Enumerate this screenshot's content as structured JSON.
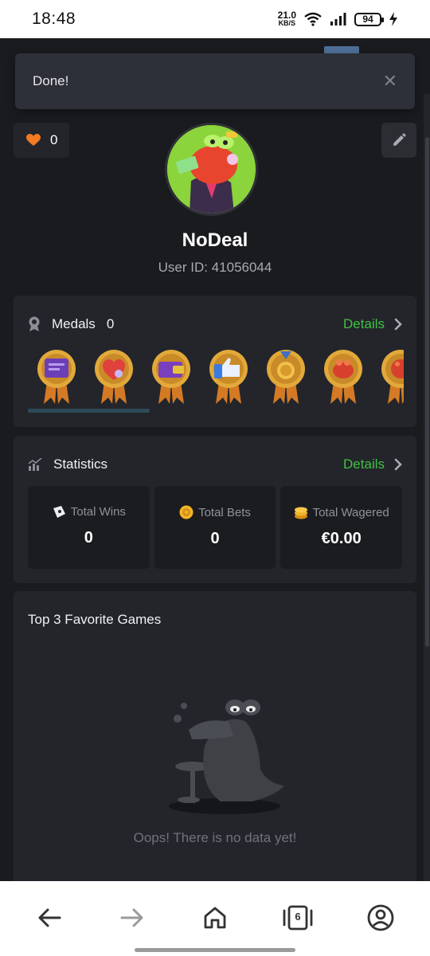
{
  "status_bar": {
    "time": "18:48",
    "net_speed_value": "21.0",
    "net_speed_unit": "KB/S",
    "battery": "94",
    "icons": [
      "wifi-icon",
      "signal-icon",
      "battery-icon",
      "charging-icon"
    ]
  },
  "toast": {
    "message": "Done!",
    "close_glyph": "✕"
  },
  "profile": {
    "likes_count": "0",
    "username": "NoDeal",
    "user_id": "User ID: 41056044"
  },
  "medals": {
    "title": "Medals",
    "count": "0",
    "details_label": "Details",
    "items": [
      "chat-medal",
      "heart-medal",
      "wallet-medal",
      "thumbs-up-medal",
      "coin-medal",
      "croc-medal",
      "croc-fist-medal"
    ]
  },
  "statistics": {
    "title": "Statistics",
    "details_label": "Details",
    "items": [
      {
        "label": "Total Wins",
        "value": "0",
        "icon": "ticket-icon"
      },
      {
        "label": "Total Bets",
        "value": "0",
        "icon": "chip-icon"
      },
      {
        "label": "Total Wagered",
        "value": "€0.00",
        "icon": "coins-icon"
      }
    ]
  },
  "favorites": {
    "title": "Top 3 Favorite Games",
    "empty_text": "Oops! There is no data yet!"
  },
  "bottom_nav": {
    "tabs_count": "6",
    "items": [
      "back-icon",
      "forward-icon",
      "home-icon",
      "tabs-icon",
      "account-icon"
    ]
  },
  "colors": {
    "background": "#1a1b1f",
    "card": "#23252b",
    "accent_green": "#3fc23f",
    "heart": "#f47a21",
    "medal_gold": "#d79a2b"
  }
}
